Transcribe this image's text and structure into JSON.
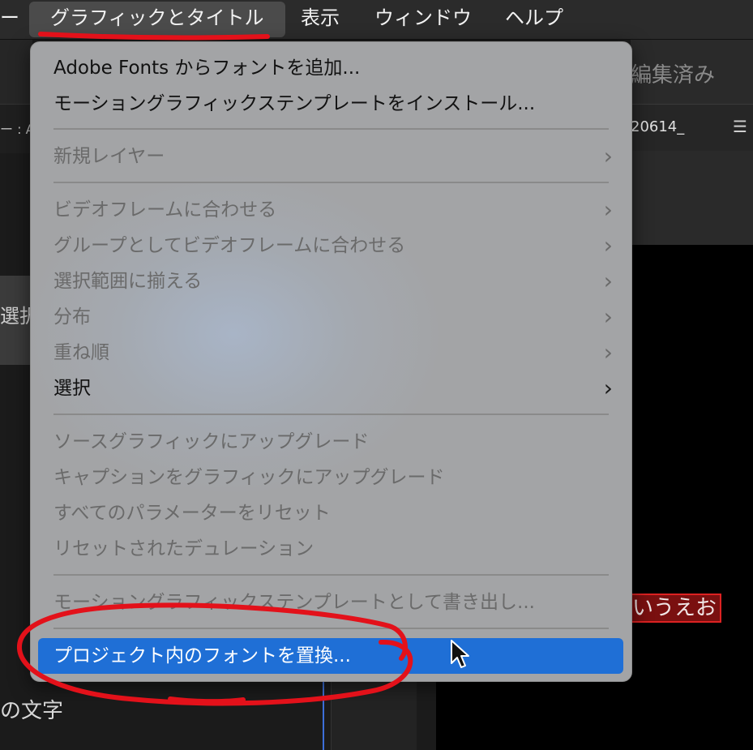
{
  "menubar": {
    "left_fragment": "ー",
    "graphics_and_titles": "グラフィックとタイトル",
    "view": "表示",
    "window": "ウィンドウ",
    "help": "ヘルプ"
  },
  "background": {
    "left_label": "ー : A",
    "left_selected_text": "選択中",
    "left_bottom_text": "の文字",
    "right_title": "編集済み",
    "right_file": "20614_",
    "right_menu_icon": "hamburger-icon",
    "video_caption": "いうえお"
  },
  "dropdown": {
    "items": [
      {
        "label": "Adobe Fonts からフォントを追加...",
        "enabled": true,
        "submenu": false
      },
      {
        "label": "モーショングラフィックステンプレートをインストール...",
        "enabled": true,
        "submenu": false
      },
      {
        "label": "新規レイヤー",
        "enabled": false,
        "submenu": true
      },
      {
        "label": "ビデオフレームに合わせる",
        "enabled": false,
        "submenu": true
      },
      {
        "label": "グループとしてビデオフレームに合わせる",
        "enabled": false,
        "submenu": true
      },
      {
        "label": "選択範囲に揃える",
        "enabled": false,
        "submenu": true
      },
      {
        "label": "分布",
        "enabled": false,
        "submenu": true
      },
      {
        "label": "重ね順",
        "enabled": false,
        "submenu": true
      },
      {
        "label": "選択",
        "enabled": true,
        "submenu": true
      },
      {
        "label": "ソースグラフィックにアップグレード",
        "enabled": false,
        "submenu": false
      },
      {
        "label": "キャプションをグラフィックにアップグレード",
        "enabled": false,
        "submenu": false
      },
      {
        "label": "すべてのパラメーターをリセット",
        "enabled": false,
        "submenu": false
      },
      {
        "label": "リセットされたデュレーション",
        "enabled": false,
        "submenu": false
      },
      {
        "label": "モーショングラフィックステンプレートとして書き出し...",
        "enabled": false,
        "submenu": false
      },
      {
        "label": "プロジェクト内のフォントを置換...",
        "enabled": true,
        "submenu": false,
        "highlighted": true
      }
    ],
    "chevron": "›"
  },
  "colors": {
    "highlight": "#1f6fd6",
    "annotation": "#e3111a",
    "caption_bg": "#7a1010"
  }
}
